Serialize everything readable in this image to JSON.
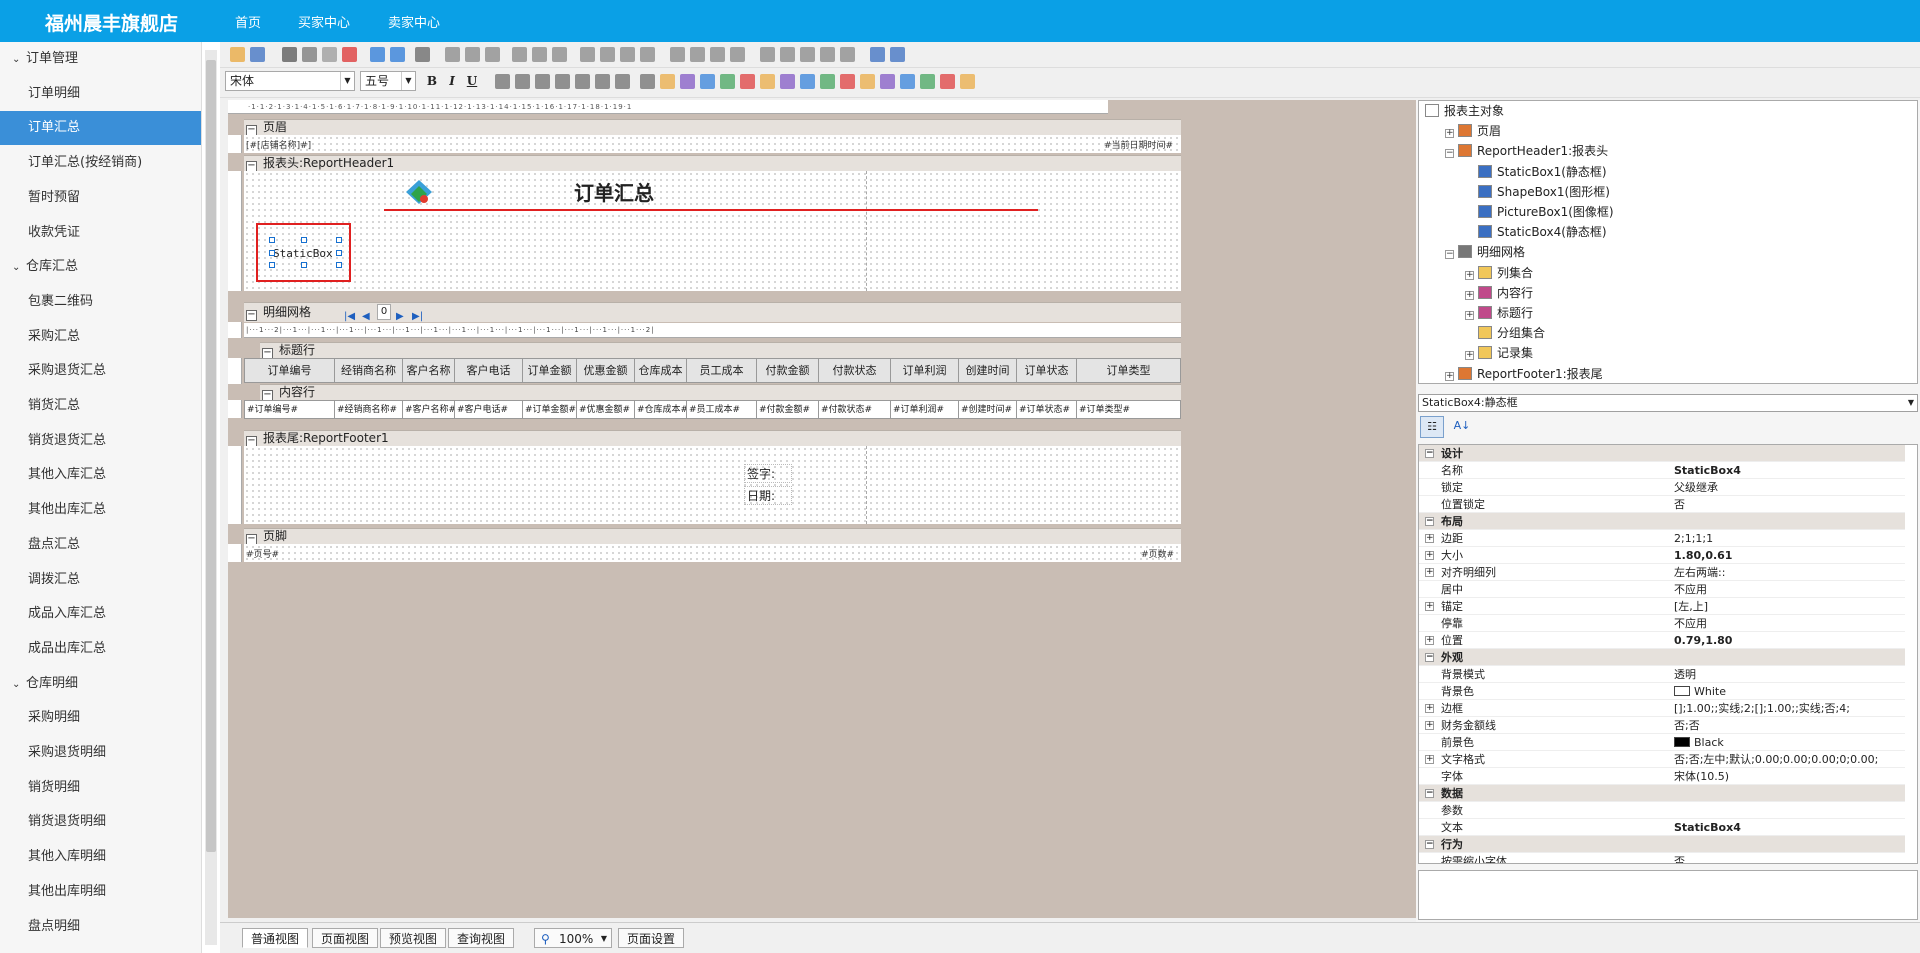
{
  "topbar": {
    "brand": "福州晨丰旗舰店",
    "nav": [
      "首页",
      "买家中心",
      "卖家中心"
    ]
  },
  "sidebar": {
    "items": [
      {
        "label": "订单管理",
        "group": true
      },
      {
        "label": "订单明细"
      },
      {
        "label": "订单汇总",
        "active": true
      },
      {
        "label": "订单汇总(按经销商)"
      },
      {
        "label": "暂时预留"
      },
      {
        "label": "收款凭证"
      },
      {
        "label": "仓库汇总",
        "group": true
      },
      {
        "label": "包裹二维码"
      },
      {
        "label": "采购汇总"
      },
      {
        "label": "采购退货汇总"
      },
      {
        "label": "销货汇总"
      },
      {
        "label": "销货退货汇总"
      },
      {
        "label": "其他入库汇总"
      },
      {
        "label": "其他出库汇总"
      },
      {
        "label": "盘点汇总"
      },
      {
        "label": "调拨汇总"
      },
      {
        "label": "成品入库汇总"
      },
      {
        "label": "成品出库汇总"
      },
      {
        "label": "仓库明细",
        "group": true
      },
      {
        "label": "采购明细"
      },
      {
        "label": "采购退货明细"
      },
      {
        "label": "销货明细"
      },
      {
        "label": "销货退货明细"
      },
      {
        "label": "其他入库明细"
      },
      {
        "label": "其他出库明细"
      },
      {
        "label": "盘点明细"
      }
    ]
  },
  "toolbar": {
    "font_name": "宋体",
    "font_size": "五号",
    "bold": "B",
    "italic": "I",
    "underline": "U"
  },
  "ruler": "·1·1·2·1·3·1·4·1·5·1·6·1·7·1·8·1·9·1·10·1·11·1·12·1·13·1·14·1·15·1·16·1·17·1·18·1·19·1",
  "report": {
    "page_header_label": "页眉",
    "store_field": "[#[店铺名称]#]",
    "date_field": "#当前日期时间#",
    "report_header_label": "报表头:ReportHeader1",
    "title": "订单汇总",
    "static_box": "StaticBox",
    "detail_grid_label": "明细网格",
    "detail_page_input": "0",
    "title_row_label": "标题行",
    "columns": [
      "订单编号",
      "经销商名称",
      "客户名称",
      "客户电话",
      "订单金额",
      "优惠金额",
      "仓库成本",
      "员工成本",
      "付款金额",
      "付款状态",
      "订单利润",
      "创建时间",
      "订单状态",
      "订单类型"
    ],
    "content_row_label": "内容行",
    "content_cells": [
      "#订单编号#",
      "#经销商名称#",
      "#客户名称#",
      "#客户电话#",
      "#订单金额#",
      "#优惠金额#",
      "#仓库成本#",
      "#员工成本#",
      "#付款金额#",
      "#付款状态#",
      "#订单利润#",
      "#创建时间#",
      "#订单状态#",
      "#订单类型#"
    ],
    "report_footer_label": "报表尾:ReportFooter1",
    "sign_label": "签字:",
    "date_label": "日期:",
    "page_footer_label": "页脚",
    "page_no_field": "#页号#",
    "page_count_field": "#页数#"
  },
  "tree": [
    {
      "label": "报表主对象",
      "level": 0
    },
    {
      "label": "页眉",
      "level": 1,
      "pm": "+"
    },
    {
      "label": "ReportHeader1:报表头",
      "level": 1,
      "pm": "−"
    },
    {
      "label": "StaticBox1(静态框)",
      "level": 2
    },
    {
      "label": "ShapeBox1(图形框)",
      "level": 2
    },
    {
      "label": "PictureBox1(图像框)",
      "level": 2
    },
    {
      "label": "StaticBox4(静态框)",
      "level": 2
    },
    {
      "label": "明细网格",
      "level": 1,
      "pm": "−"
    },
    {
      "label": "列集合",
      "level": 2,
      "pm": "+"
    },
    {
      "label": "内容行",
      "level": 2,
      "pm": "+"
    },
    {
      "label": "标题行",
      "level": 2,
      "pm": "+"
    },
    {
      "label": "分组集合",
      "level": 2
    },
    {
      "label": "记录集",
      "level": 2,
      "pm": "+"
    },
    {
      "label": "ReportFooter1:报表尾",
      "level": 1,
      "pm": "+"
    }
  ],
  "object_selector": "StaticBox4:静态框",
  "properties": [
    {
      "key": "设计",
      "cat": true
    },
    {
      "key": "名称",
      "value": "StaticBox4",
      "bold": true
    },
    {
      "key": "锁定",
      "value": "父级继承"
    },
    {
      "key": "位置锁定",
      "value": "否"
    },
    {
      "key": "布局",
      "cat": true
    },
    {
      "key": "边距",
      "value": "2;1;1;1",
      "pm": true
    },
    {
      "key": "大小",
      "value": "1.80,0.61",
      "pm": true,
      "bold": true
    },
    {
      "key": "对齐明细列",
      "value": "左右两端::",
      "pm": true
    },
    {
      "key": "居中",
      "value": "不应用"
    },
    {
      "key": "锚定",
      "value": "[左,上]",
      "pm": true
    },
    {
      "key": "停靠",
      "value": "不应用"
    },
    {
      "key": "位置",
      "value": "0.79,1.80",
      "pm": true,
      "bold": true
    },
    {
      "key": "外观",
      "cat": true
    },
    {
      "key": "背景模式",
      "value": "透明"
    },
    {
      "key": "背景色",
      "value": "White",
      "swatch": "#ffffff"
    },
    {
      "key": "边框",
      "value": "[];1.00;;实线;2;[];1.00;;实线;否;4;",
      "pm": true
    },
    {
      "key": "财务金额线",
      "value": "否;否",
      "pm": true
    },
    {
      "key": "前景色",
      "value": "Black",
      "swatch": "#000000"
    },
    {
      "key": "文字格式",
      "value": "否;否;左中;默认;0.00;0.00;0.00;0;0.00;",
      "pm": true
    },
    {
      "key": "字体",
      "value": "宋体(10.5)"
    },
    {
      "key": "数据",
      "cat": true
    },
    {
      "key": "参数",
      "value": ""
    },
    {
      "key": "文本",
      "value": "StaticBox4",
      "bold": true
    },
    {
      "key": "行为",
      "cat": true
    },
    {
      "key": "按需缩小字体",
      "value": "否"
    }
  ],
  "bottom_tabs": [
    "普通视图",
    "页面视图",
    "预览视图",
    "查询视图"
  ],
  "zoom": "100%",
  "page_setup": "页面设置"
}
